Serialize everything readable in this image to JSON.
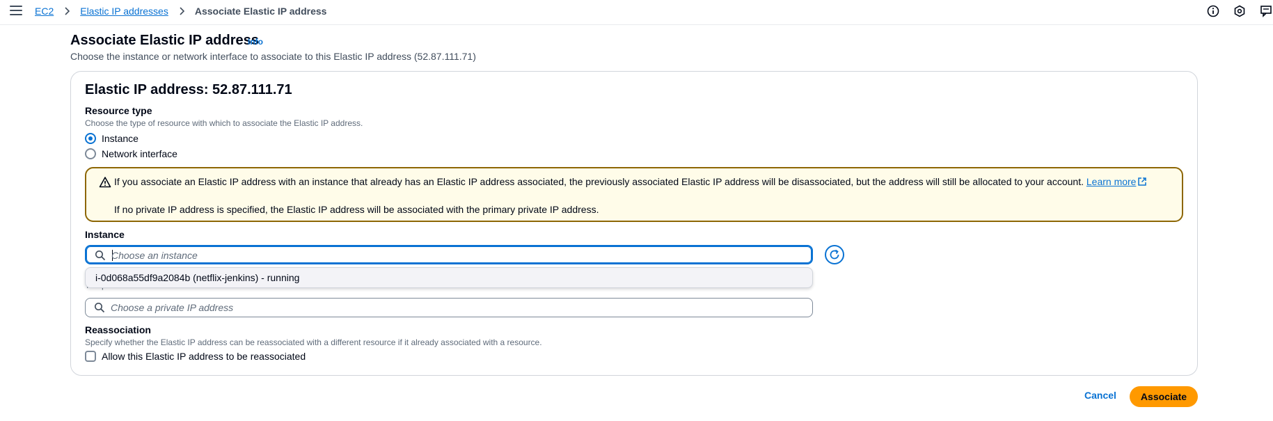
{
  "breadcrumb": {
    "items": [
      "EC2",
      "Elastic IP addresses"
    ],
    "current": "Associate Elastic IP address"
  },
  "header": {
    "title": "Associate Elastic IP address",
    "info_label": "Info",
    "description": "Choose the instance or network interface to associate to this Elastic IP address (52.87.111.71)"
  },
  "form": {
    "heading": "Elastic IP address: 52.87.111.71",
    "resource_type": {
      "label": "Resource type",
      "description": "Choose the type of resource with which to associate the Elastic IP address.",
      "options": [
        "Instance",
        "Network interface"
      ],
      "selected": "Instance"
    },
    "alert": {
      "text1": "If you associate an Elastic IP address with an instance that already has an Elastic IP address associated, the previously associated Elastic IP address will be disassociated, but the address will still be allocated to your account.",
      "link": "Learn more",
      "text2": "If no private IP address is specified, the Elastic IP address will be associated with the primary private IP address."
    },
    "instance": {
      "label": "Instance",
      "placeholder": "Choose an instance",
      "value": "",
      "dropdown_option": "i-0d068a55df9a2084b (netflix-jenkins) - running"
    },
    "private_ip": {
      "description": "The private IP address with which to associate the Elastic IP address.",
      "placeholder": "Choose a private IP address",
      "value": ""
    },
    "reassociation": {
      "label": "Reassociation",
      "description": "Specify whether the Elastic IP address can be reassociated with a different resource if it already associated with a resource.",
      "checkbox_label": "Allow this Elastic IP address to be reassociated",
      "checked": false
    }
  },
  "footer": {
    "cancel_label": "Cancel",
    "associate_label": "Associate"
  },
  "colors": {
    "accent": "#0972d3",
    "primary_button": "#ff9900",
    "warning_border": "#8d6605",
    "warning_bg": "#fffce9"
  },
  "icons": [
    "menu-icon",
    "chevron-right-icon",
    "info-circle-icon",
    "settings-hexagon-icon",
    "feedback-icon",
    "warning-icon",
    "external-link-icon",
    "search-icon",
    "refresh-icon"
  ]
}
